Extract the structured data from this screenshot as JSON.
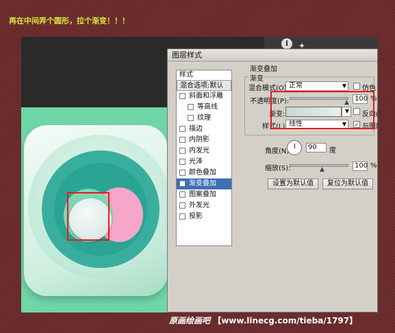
{
  "caption": "再在中间弄个圆形，拉个渐变！！！",
  "dialog": {
    "title": "图层样式",
    "styles_header": "样式",
    "blend_options": "混合选项:默认",
    "items": [
      {
        "label": "斜面和浮雕",
        "checked": false
      },
      {
        "label": "等高线",
        "checked": false
      },
      {
        "label": "纹理",
        "checked": false
      },
      {
        "label": "描边",
        "checked": false
      },
      {
        "label": "内阴影",
        "checked": false
      },
      {
        "label": "内发光",
        "checked": false
      },
      {
        "label": "光泽",
        "checked": false
      },
      {
        "label": "颜色叠加",
        "checked": false
      },
      {
        "label": "渐变叠加",
        "checked": true,
        "selected": true
      },
      {
        "label": "图案叠加",
        "checked": false
      },
      {
        "label": "外发光",
        "checked": false
      },
      {
        "label": "投影",
        "checked": false
      }
    ],
    "panel_title": "渐变叠加",
    "group_title": "渐变",
    "blend_mode_label": "混合模式(O):",
    "blend_mode_value": "正常",
    "dither_label": "仿色",
    "opacity_label": "不透明度(P):",
    "opacity_value": "100",
    "opacity_unit": "%",
    "gradient_label": "渐变:",
    "reverse_label": "反向(R)",
    "style_label": "样式(L):",
    "style_value": "线性",
    "align_label": "与图层",
    "angle_label": "角度(N):",
    "angle_value": "90",
    "angle_unit": "度",
    "scale_label": "缩放(S):",
    "scale_value": "100",
    "scale_unit": "%",
    "make_default": "设置为默认值",
    "reset_default": "复位为默认值"
  },
  "footer": {
    "brand": "原画绘画吧",
    "url": "【www.linecg.com/tieba/1797】"
  },
  "colors": {
    "highlight": "#e8191c",
    "selected": "#3d6fb4",
    "background": "#6b2a2a"
  }
}
